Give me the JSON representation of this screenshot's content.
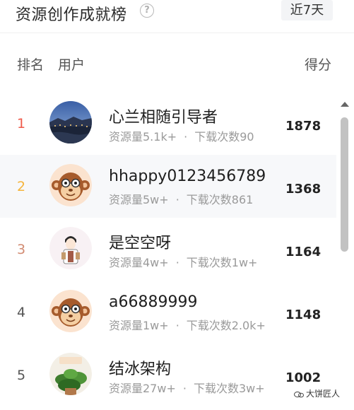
{
  "header": {
    "title": "资源创作成就榜",
    "help": "?",
    "period": "近7天"
  },
  "columns": {
    "rank": "排名",
    "user": "用户",
    "score": "得分"
  },
  "colors": {
    "rank1": "#ef5a4a",
    "rank2": "#f5b43b",
    "rank3": "#d28b72",
    "rankN": "#555555"
  },
  "rows": [
    {
      "rank": "1",
      "name": "心兰相随引导者",
      "resources": "资源量5.1k+",
      "dot": "·",
      "downloads": "下载次数90",
      "score": "1878",
      "avatar": "night-city-photo"
    },
    {
      "rank": "2",
      "name": "hhappy0123456789",
      "resources": "资源量5w+",
      "dot": "·",
      "downloads": "下载次数861",
      "score": "1368",
      "avatar": "monkey-avatar"
    },
    {
      "rank": "3",
      "name": "是空空呀",
      "resources": "资源量4w+",
      "dot": "·",
      "downloads": "下载次数1w+",
      "score": "1164",
      "avatar": "cartoon-person-avatar"
    },
    {
      "rank": "4",
      "name": "a66889999",
      "resources": "资源量1w+",
      "dot": "·",
      "downloads": "下载次数2.0k+",
      "score": "1148",
      "avatar": "monkey-avatar"
    },
    {
      "rank": "5",
      "name": "结冰架构",
      "resources": "资源量27w+",
      "dot": "·",
      "downloads": "下载次数3w+",
      "score": "1002",
      "avatar": "plant-photo"
    }
  ],
  "watermark": "大饼匠人"
}
